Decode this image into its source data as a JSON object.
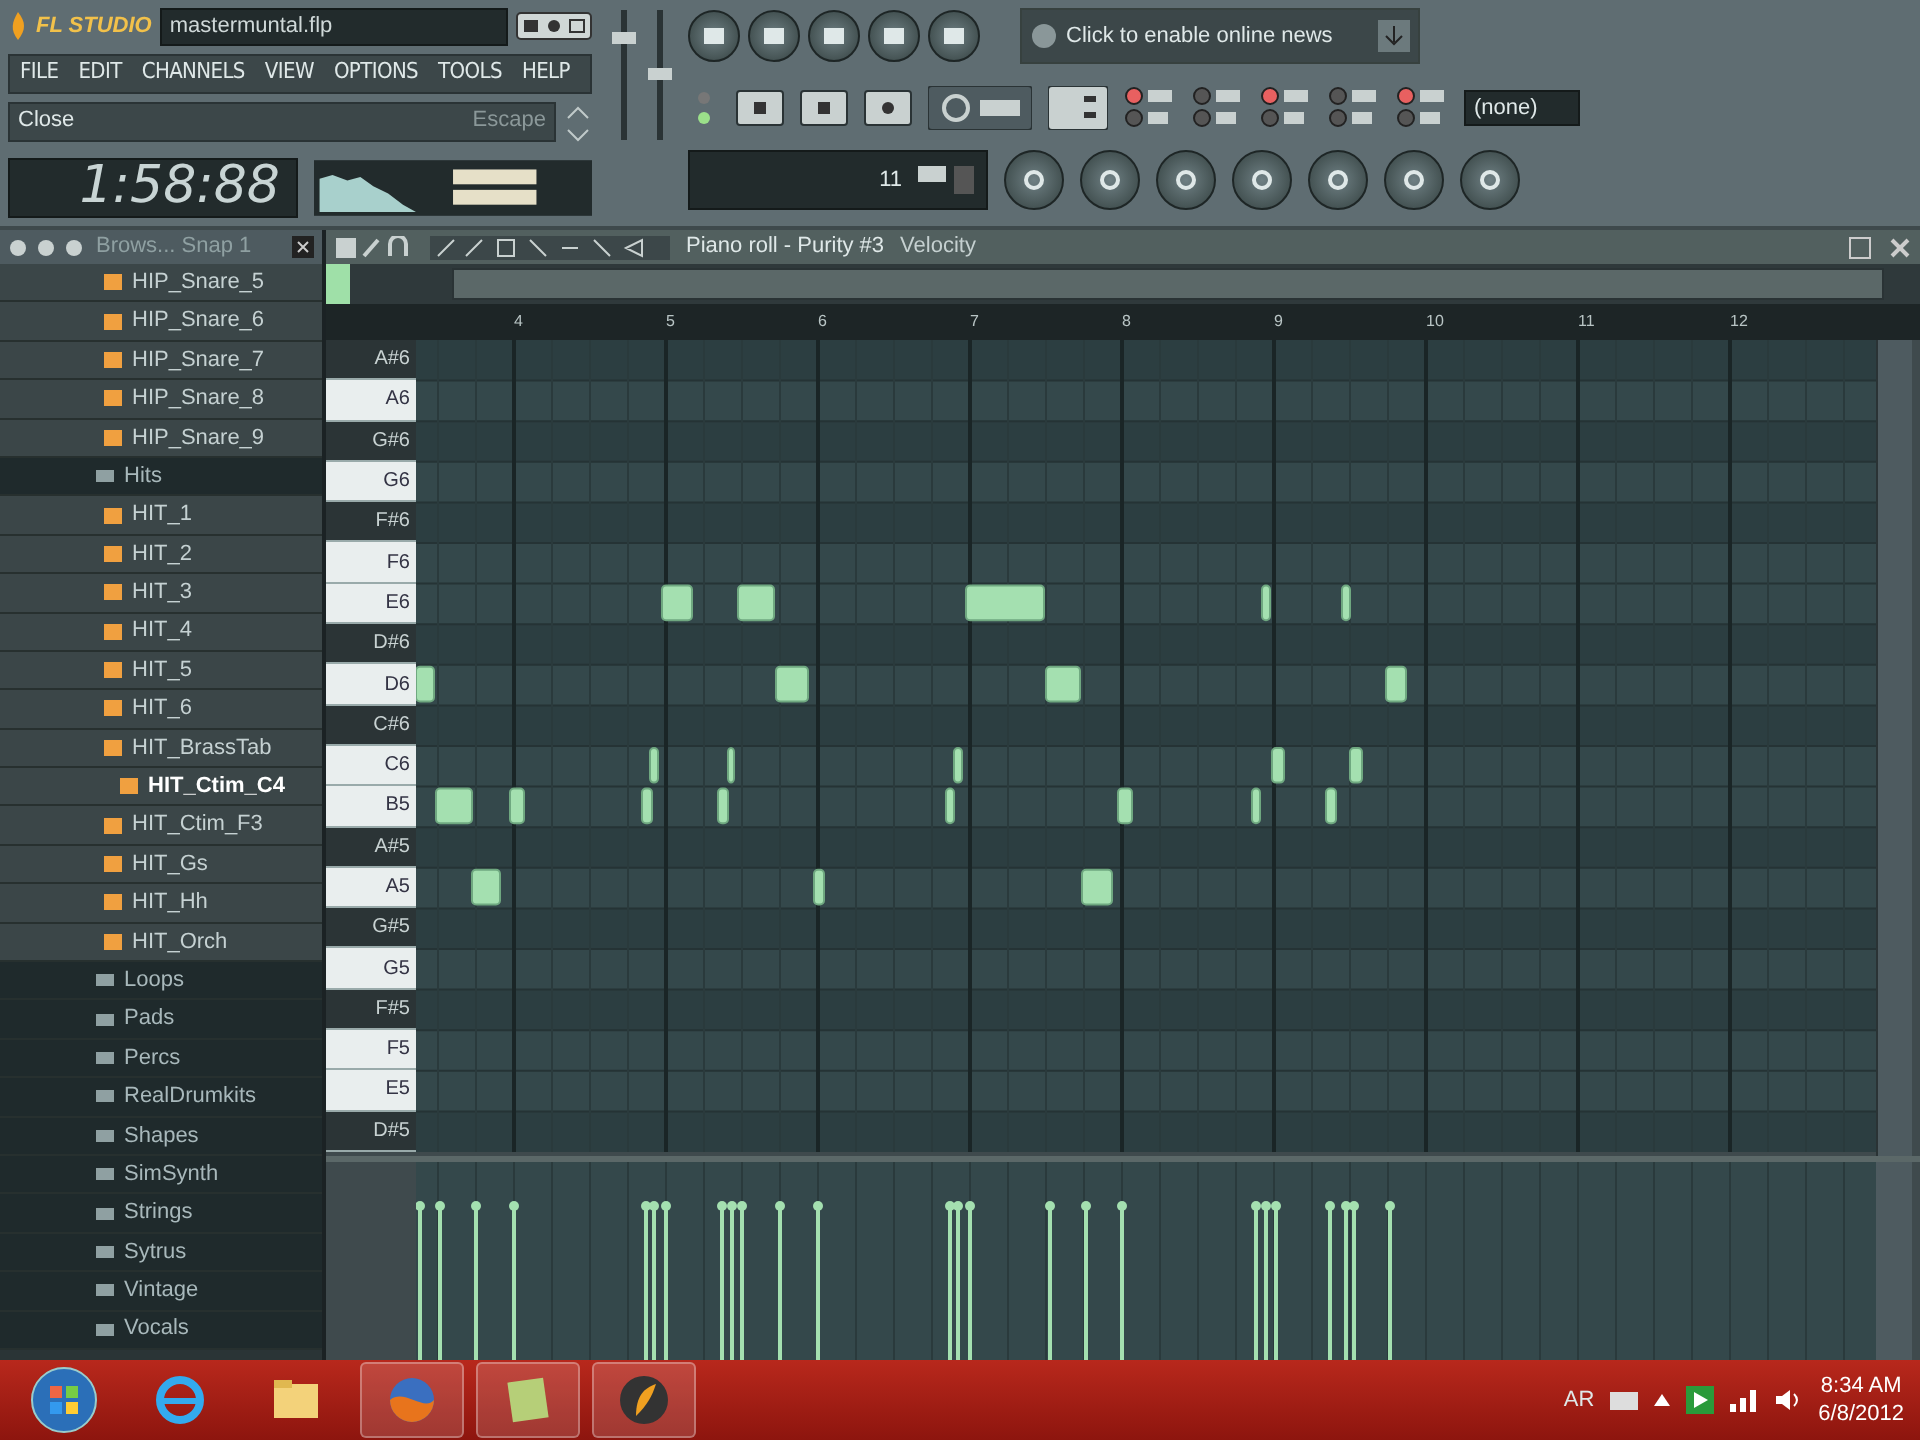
{
  "app": {
    "logo": "FL STUDIO",
    "filename": "mastermuntal.flp"
  },
  "menu": [
    "FILE",
    "EDIT",
    "CHANNELS",
    "VIEW",
    "OPTIONS",
    "TOOLS",
    "HELP"
  ],
  "hint_bar": {
    "action": "Close",
    "shortcut": "Escape"
  },
  "time_display": "1:58:88",
  "cpu_panel": {
    "reading": "11"
  },
  "news": {
    "text": "Click to enable online news"
  },
  "pattern_selector": {
    "value": "(none)"
  },
  "browser": {
    "title": "Brows... Snap 1",
    "items": [
      {
        "label": "HIP_Snare_5",
        "kind": "file",
        "selected": false
      },
      {
        "label": "HIP_Snare_6",
        "kind": "file",
        "selected": false
      },
      {
        "label": "HIP_Snare_7",
        "kind": "file",
        "selected": false
      },
      {
        "label": "HIP_Snare_8",
        "kind": "file",
        "selected": false
      },
      {
        "label": "HIP_Snare_9",
        "kind": "file",
        "selected": false
      },
      {
        "label": "Hits",
        "kind": "folder",
        "selected": false
      },
      {
        "label": "HIT_1",
        "kind": "file",
        "selected": false
      },
      {
        "label": "HIT_2",
        "kind": "file",
        "selected": false
      },
      {
        "label": "HIT_3",
        "kind": "file",
        "selected": false
      },
      {
        "label": "HIT_4",
        "kind": "file",
        "selected": false
      },
      {
        "label": "HIT_5",
        "kind": "file",
        "selected": false
      },
      {
        "label": "HIT_6",
        "kind": "file",
        "selected": false
      },
      {
        "label": "HIT_BrassTab",
        "kind": "file",
        "selected": false
      },
      {
        "label": "HIT_Ctim_C4",
        "kind": "file",
        "selected": true
      },
      {
        "label": "HIT_Ctim_F3",
        "kind": "file",
        "selected": false
      },
      {
        "label": "HIT_Gs",
        "kind": "file",
        "selected": false
      },
      {
        "label": "HIT_Hh",
        "kind": "file",
        "selected": false
      },
      {
        "label": "HIT_Orch",
        "kind": "file",
        "selected": false
      },
      {
        "label": "Loops",
        "kind": "folder",
        "selected": false
      },
      {
        "label": "Pads",
        "kind": "folder",
        "selected": false
      },
      {
        "label": "Percs",
        "kind": "folder",
        "selected": false
      },
      {
        "label": "RealDrumkits",
        "kind": "folder",
        "selected": false
      },
      {
        "label": "Shapes",
        "kind": "folder",
        "selected": false
      },
      {
        "label": "SimSynth",
        "kind": "folder",
        "selected": false
      },
      {
        "label": "Strings",
        "kind": "folder",
        "selected": false
      },
      {
        "label": "Sytrus",
        "kind": "folder",
        "selected": false
      },
      {
        "label": "Vintage",
        "kind": "folder",
        "selected": false
      },
      {
        "label": "Vocals",
        "kind": "folder",
        "selected": false
      }
    ]
  },
  "piano_roll": {
    "title": "Piano roll - Purity #3",
    "target": "Velocity",
    "ruler": [
      "4",
      "5",
      "6",
      "7",
      "8",
      "9",
      "10",
      "11",
      "12"
    ],
    "keys": [
      {
        "label": "A#6",
        "kind": "black"
      },
      {
        "label": "A6",
        "kind": "white"
      },
      {
        "label": "G#6",
        "kind": "black"
      },
      {
        "label": "G6",
        "kind": "white"
      },
      {
        "label": "F#6",
        "kind": "black"
      },
      {
        "label": "F6",
        "kind": "white"
      },
      {
        "label": "E6",
        "kind": "white"
      },
      {
        "label": "D#6",
        "kind": "black"
      },
      {
        "label": "D6",
        "kind": "white"
      },
      {
        "label": "C#6",
        "kind": "black"
      },
      {
        "label": "C6",
        "kind": "white"
      },
      {
        "label": "B5",
        "kind": "white"
      },
      {
        "label": "A#5",
        "kind": "black"
      },
      {
        "label": "A5",
        "kind": "white"
      },
      {
        "label": "G#5",
        "kind": "black"
      },
      {
        "label": "G5",
        "kind": "white"
      },
      {
        "label": "F#5",
        "kind": "black"
      },
      {
        "label": "F5",
        "kind": "white"
      },
      {
        "label": "E5",
        "kind": "white"
      },
      {
        "label": "D#5",
        "kind": "black"
      }
    ]
  },
  "taskbar": {
    "language": "AR",
    "time": "8:34 AM",
    "date": "6/8/2012"
  }
}
